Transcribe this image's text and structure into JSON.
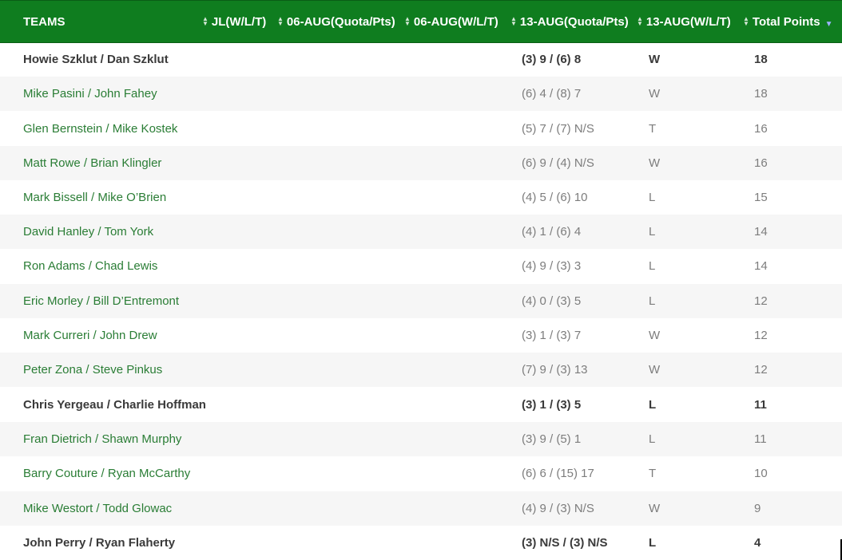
{
  "header": {
    "columns": [
      {
        "label": "TEAMS"
      },
      {
        "label": "JL(W/L/T)"
      },
      {
        "label": "06-AUG(Quota/Pts)"
      },
      {
        "label": "06-AUG(W/L/T)"
      },
      {
        "label": "13-AUG(Quota/Pts)"
      },
      {
        "label": "13-AUG(W/L/T)"
      },
      {
        "label": "Total Points"
      }
    ]
  },
  "colors": {
    "header_bg": "#0f7d1f",
    "team_link": "#2a7d35",
    "row_alt": "#f6f6f6"
  },
  "rows": [
    {
      "team": "Howie Szklut / Dan Szklut",
      "q13": "(3) 9 / (6) 8",
      "wlt13": "W",
      "pts": "18",
      "bold": true
    },
    {
      "team": "Mike Pasini / John Fahey",
      "q13": "(6) 4 / (8) 7",
      "wlt13": "W",
      "pts": "18",
      "bold": false
    },
    {
      "team": "Glen Bernstein / Mike Kostek",
      "q13": "(5) 7 / (7) N/S",
      "wlt13": "T",
      "pts": "16",
      "bold": false
    },
    {
      "team": "Matt Rowe / Brian Klingler",
      "q13": "(6) 9 / (4) N/S",
      "wlt13": "W",
      "pts": "16",
      "bold": false
    },
    {
      "team": "Mark Bissell / Mike O’Brien",
      "q13": "(4) 5 / (6) 10",
      "wlt13": "L",
      "pts": "15",
      "bold": false
    },
    {
      "team": "David Hanley / Tom York",
      "q13": "(4) 1 / (6) 4",
      "wlt13": "L",
      "pts": "14",
      "bold": false
    },
    {
      "team": "Ron Adams / Chad Lewis",
      "q13": "(4) 9 / (3) 3",
      "wlt13": "L",
      "pts": "14",
      "bold": false
    },
    {
      "team": "Eric Morley / Bill D’Entremont",
      "q13": "(4) 0 / (3) 5",
      "wlt13": "L",
      "pts": "12",
      "bold": false
    },
    {
      "team": "Mark Curreri / John Drew",
      "q13": "(3) 1 / (3) 7",
      "wlt13": "W",
      "pts": "12",
      "bold": false
    },
    {
      "team": "Peter Zona / Steve Pinkus",
      "q13": "(7) 9 / (3) 13",
      "wlt13": "W",
      "pts": "12",
      "bold": false
    },
    {
      "team": "Chris Yergeau / Charlie Hoffman",
      "q13": "(3) 1 / (3) 5",
      "wlt13": "L",
      "pts": "11",
      "bold": true
    },
    {
      "team": "Fran Dietrich / Shawn Murphy",
      "q13": "(3) 9 / (5) 1",
      "wlt13": "L",
      "pts": "11",
      "bold": false
    },
    {
      "team": "Barry Couture / Ryan McCarthy",
      "q13": "(6) 6 / (15) 17",
      "wlt13": "T",
      "pts": "10",
      "bold": false
    },
    {
      "team": "Mike Westort / Todd Glowac",
      "q13": "(4) 9 / (3) N/S",
      "wlt13": "W",
      "pts": "9",
      "bold": false
    },
    {
      "team": "John Perry / Ryan Flaherty",
      "q13": "(3) N/S / (3) N/S",
      "wlt13": "L",
      "pts": "4",
      "bold": true
    }
  ]
}
